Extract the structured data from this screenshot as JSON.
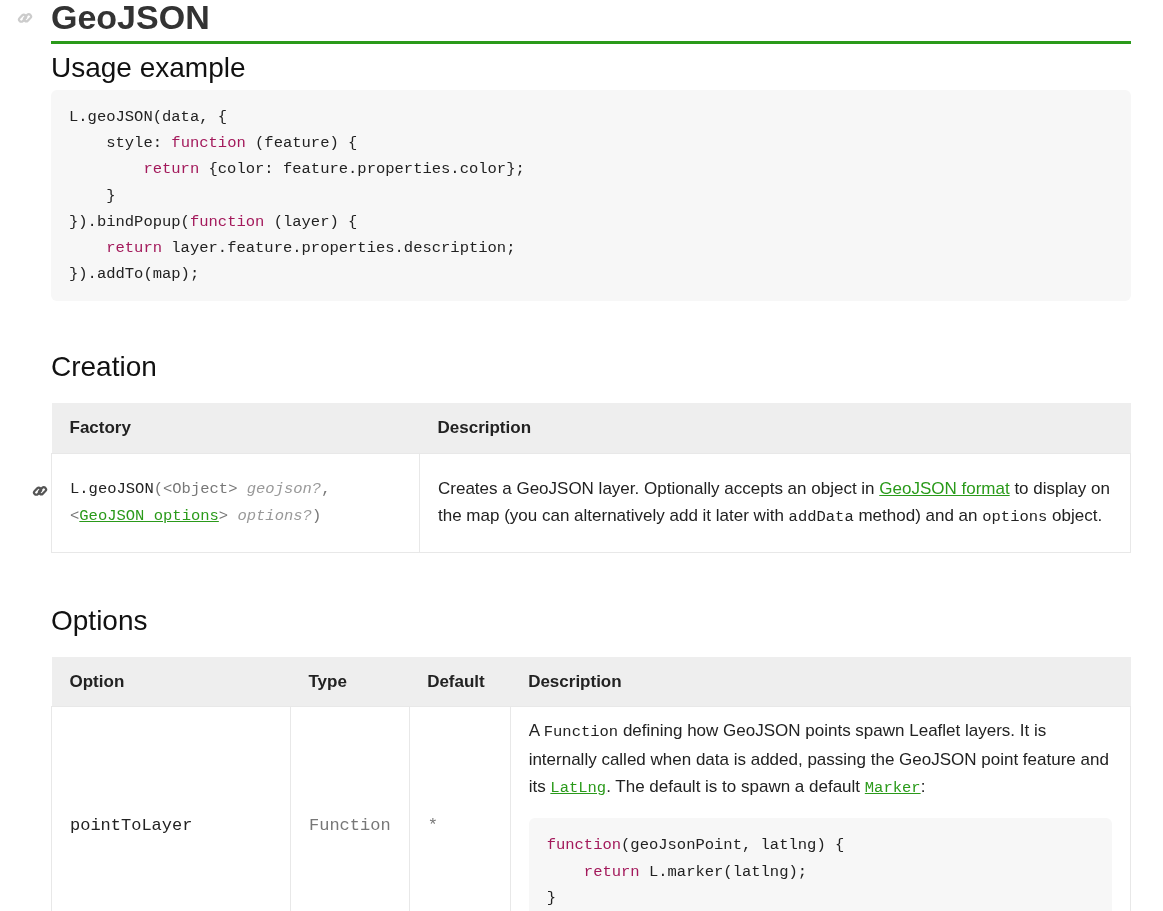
{
  "page_title": "GeoJSON",
  "usage_example": {
    "heading": "Usage example",
    "code": [
      {
        "tokens": [
          {
            "kind": "plain",
            "text": "L.geoJSON(data, {"
          }
        ],
        "children": [
          {
            "tokens": [
              {
                "kind": "plain",
                "text": "style: "
              },
              {
                "kind": "keyword",
                "text": "function"
              },
              {
                "kind": "plain",
                "text": " (feature) {"
              }
            ],
            "children": [
              {
                "tokens": [
                  {
                    "kind": "keyword",
                    "text": "return"
                  },
                  {
                    "kind": "plain",
                    "text": " {color: feature.properties.color};"
                  }
                ]
              }
            ]
          },
          {
            "tokens": [
              {
                "kind": "plain",
                "text": "}"
              }
            ]
          }
        ]
      },
      {
        "tokens": [
          {
            "kind": "plain",
            "text": "}).bindPopup("
          },
          {
            "kind": "keyword",
            "text": "function"
          },
          {
            "kind": "plain",
            "text": " (layer) {"
          }
        ],
        "children": [
          {
            "tokens": [
              {
                "kind": "keyword",
                "text": "return"
              },
              {
                "kind": "plain",
                "text": " layer.feature.properties.description;"
              }
            ]
          }
        ]
      },
      {
        "tokens": [
          {
            "kind": "plain",
            "text": "}).addTo(map);"
          }
        ]
      }
    ]
  },
  "creation": {
    "heading": "Creation",
    "columns": [
      "Factory",
      "Description"
    ],
    "rows": [
      {
        "factory": [
          {
            "kind": "name",
            "text": "L.geoJSON"
          },
          {
            "kind": "punct",
            "text": "(<Object> "
          },
          {
            "kind": "param",
            "text": "geojson?"
          },
          {
            "kind": "punct",
            "text": ", <"
          },
          {
            "kind": "link",
            "text": "GeoJSON options"
          },
          {
            "kind": "punct",
            "text": "> "
          },
          {
            "kind": "param",
            "text": "options?"
          },
          {
            "kind": "punct",
            "text": ")"
          }
        ],
        "description": [
          {
            "kind": "text",
            "text": "Creates a GeoJSON layer. Optionally accepts an object in "
          },
          {
            "kind": "link",
            "text": "GeoJSON format"
          },
          {
            "kind": "text",
            "text": " to display on the map (you can alternatively add it later with "
          },
          {
            "kind": "code",
            "text": "addData"
          },
          {
            "kind": "text",
            "text": " method) and an "
          },
          {
            "kind": "code",
            "text": "options"
          },
          {
            "kind": "text",
            "text": " object."
          }
        ]
      }
    ]
  },
  "options": {
    "heading": "Options",
    "columns": [
      "Option",
      "Type",
      "Default",
      "Description"
    ],
    "rows": [
      {
        "option": "pointToLayer",
        "type": "Function",
        "default": "*",
        "description": [
          {
            "kind": "text",
            "text": "A "
          },
          {
            "kind": "code",
            "text": "Function"
          },
          {
            "kind": "text",
            "text": " defining how GeoJSON points spawn Leaflet layers. It is internally called when data is added, passing the GeoJSON point feature and its "
          },
          {
            "kind": "code-link",
            "text": "LatLng"
          },
          {
            "kind": "text",
            "text": ". The default is to spawn a default "
          },
          {
            "kind": "code-link",
            "text": "Marker"
          },
          {
            "kind": "text",
            "text": ":"
          }
        ],
        "code": [
          {
            "tokens": [
              {
                "kind": "keyword",
                "text": "function"
              },
              {
                "kind": "plain",
                "text": "(geoJsonPoint, latlng) {"
              }
            ],
            "children": [
              {
                "tokens": [
                  {
                    "kind": "keyword",
                    "text": "return"
                  },
                  {
                    "kind": "plain",
                    "text": " L.marker(latlng);"
                  }
                ]
              }
            ]
          },
          {
            "tokens": [
              {
                "kind": "plain",
                "text": "}"
              }
            ]
          }
        ]
      }
    ]
  }
}
